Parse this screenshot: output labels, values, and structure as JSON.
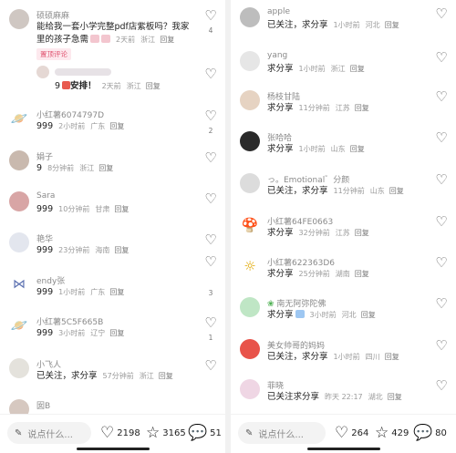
{
  "left": {
    "comments": [
      {
        "name": "硕硕麻麻",
        "text_line1": "能给我一套小学完整pdf店紫板吗？我家",
        "text_line2": "里的孩子急需",
        "time": "2天前",
        "location": "浙江",
        "reply": "回复",
        "likes": "4",
        "tag": "置顶评论"
      },
      {
        "reply_text": "9",
        "reply_text2": "安排！",
        "time": "2天前",
        "location": "浙江",
        "reply": "回复"
      },
      {
        "name": "小红薯6074797D",
        "text": "999",
        "time": "2小时前",
        "location": "广东",
        "reply": "回复",
        "likes": "2"
      },
      {
        "name": "娟子",
        "text": "9",
        "time": "8分钟前",
        "location": "浙江",
        "reply": "回复"
      },
      {
        "name": "Sara",
        "text": "999",
        "time": "10分钟前",
        "location": "甘肃",
        "reply": "回复"
      },
      {
        "name": "艳华",
        "text": "999",
        "time": "23分钟前",
        "location": "海南",
        "reply": "回复"
      },
      {
        "name": "endy张",
        "text": "999",
        "time": "1小时前",
        "location": "广东",
        "reply": "回复",
        "likes": "3"
      },
      {
        "name": "小红薯5C5F665B",
        "text": "999",
        "time": "3小时前",
        "location": "辽宁",
        "reply": "回复",
        "likes": "1"
      },
      {
        "name": "小飞人",
        "text": "已关注，求分享",
        "time": "57分钟前",
        "location": "浙江",
        "reply": "回复"
      },
      {
        "name": "囡B"
      }
    ],
    "bottom": {
      "placeholder": "说点什么...",
      "likes": "2198",
      "stars": "3165",
      "comments": "51"
    }
  },
  "right": {
    "comments": [
      {
        "name": "apple",
        "text": "已关注，求分享",
        "time": "1小时前",
        "location": "河北",
        "reply": "回复"
      },
      {
        "name": "yang",
        "text": "求分享",
        "time": "1小时前",
        "location": "浙江",
        "reply": "回复"
      },
      {
        "name": "杨枝甘陆",
        "text": "求分享",
        "time": "11分钟前",
        "location": "江苏",
        "reply": "回复"
      },
      {
        "name": "张哈哈",
        "text": "求分享",
        "time": "1小时前",
        "location": "山东",
        "reply": "回复"
      },
      {
        "name": "っ。Emotional゛分颜",
        "text": "已关注，求分享",
        "time": "11分钟前",
        "location": "山东",
        "reply": "回复"
      },
      {
        "name": "小红薯64FE0663",
        "text": "求分享",
        "time": "32分钟前",
        "location": "江苏",
        "reply": "回复"
      },
      {
        "name": "小红薯622363D6",
        "text": "求分享",
        "time": "25分钟前",
        "location": "湖南",
        "reply": "回复"
      },
      {
        "name": "南无阿弥陀佛",
        "text": "求分享",
        "time": "3小时前",
        "location": "河北",
        "reply": "回复"
      },
      {
        "name": "美女帅哥的妈妈",
        "text": "已关注，求分享",
        "time": "1小时前",
        "location": "四川",
        "reply": "回复"
      },
      {
        "name": "菲晓",
        "text": "已关注求分享",
        "time": "昨天 22:17",
        "location": "湖北",
        "reply": "回复"
      }
    ],
    "bottom": {
      "placeholder": "说点什么...",
      "likes": "264",
      "stars": "429",
      "comments": "80"
    }
  },
  "icons": {
    "heart": "heart-outline-icon",
    "star": "star-outline-icon",
    "comment": "comment-bubble-icon",
    "pen": "pen-icon"
  }
}
